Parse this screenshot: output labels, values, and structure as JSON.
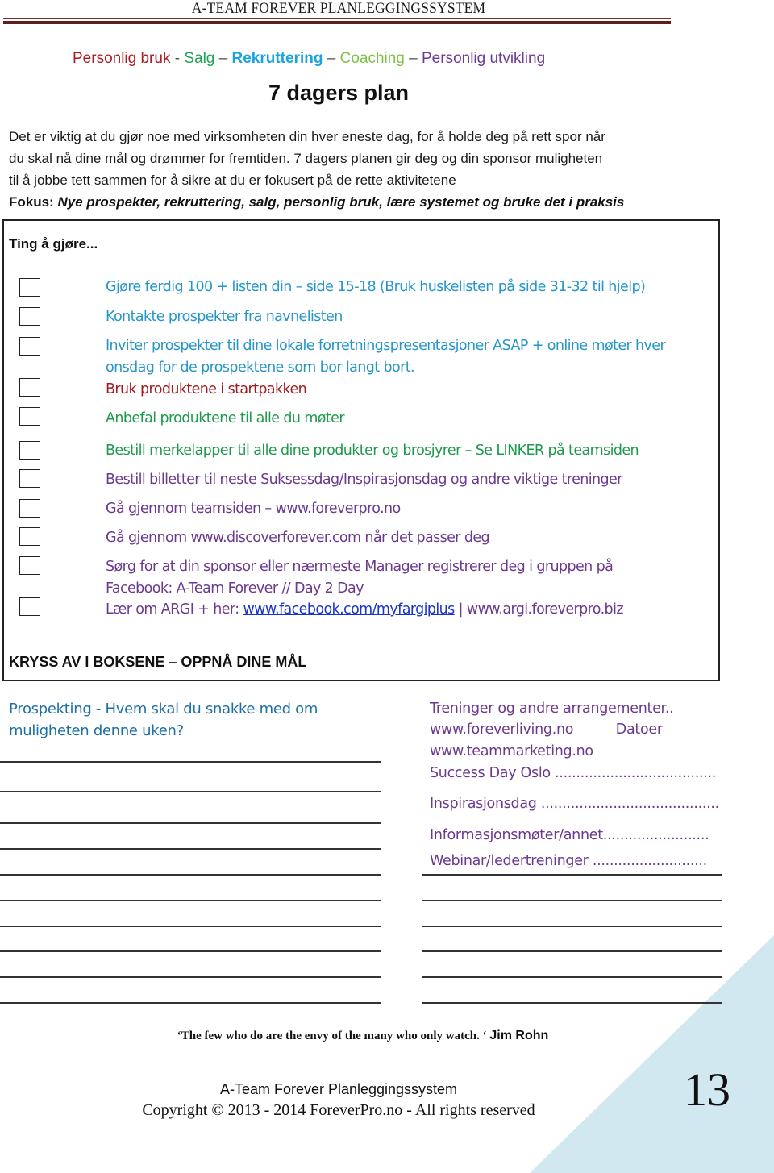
{
  "header": {
    "title": "A-TEAM FOREVER PLANLEGGINGSSYSTEM",
    "rule_color": "#5e1f1f"
  },
  "tagline": [
    {
      "text": "Personlig bruk",
      "color": "#ad1c24"
    },
    {
      "text": " - ",
      "color": "#555555"
    },
    {
      "text": "Salg",
      "color": "#1fa055"
    },
    {
      "text": " – ",
      "color": "#555555"
    },
    {
      "text": "Rekruttering",
      "color": "#1aa3de"
    },
    {
      "text": " – ",
      "color": "#555555"
    },
    {
      "text": "Coaching",
      "color": "#7dc243"
    },
    {
      "text": " – ",
      "color": "#555555"
    },
    {
      "text": "Personlig utvikling",
      "color": "#6f3a96"
    }
  ],
  "page_title": "7 dagers plan",
  "intro": {
    "lines": [
      "Det er viktig at du gjør noe med virksomheten din hver eneste dag, for å holde deg på rett spor når",
      "du skal nå dine mål og drømmer for fremtiden. 7 dagers planen gir deg og din sponsor muligheten",
      "til å jobbe tett sammen for å sikre at du er fokusert på de rette aktivitetene"
    ],
    "focus_label": "Fokus:",
    "focus_text": " Nye prospekter, rekruttering, salg, personlig bruk, lære systemet og bruke det i praksis"
  },
  "todo": {
    "heading": "Ting å gjøre...",
    "footer": "KRYSS AV I BOKSENE – OPPNÅ DINE MÅL",
    "items": [
      {
        "lines": [
          "Gjøre ferdig 100 + listen din – side 15-18 (Bruk huskelisten på side 31-32 til hjelp)"
        ],
        "color": "#2596c8",
        "checked": false
      },
      {
        "lines": [
          "Kontakte prospekter fra navnelisten"
        ],
        "color": "#2596c8",
        "checked": false
      },
      {
        "lines": [
          "Inviter prospekter til dine lokale forretningspresentasjoner ASAP + online møter hver",
          "onsdag for de prospektene som bor langt bort."
        ],
        "color": "#2596c8",
        "checked": false
      },
      {
        "lines": [
          "Bruk produktene i startpakken"
        ],
        "color": "#a01c20",
        "checked": false
      },
      {
        "lines": [
          "Anbefal produktene til alle du møter"
        ],
        "color": "#1e9a4c",
        "checked": false
      },
      {
        "lines": [
          "Bestill merkelapper til alle dine produkter og brosjyrer – Se LINKER på teamsiden"
        ],
        "color": "#1e9a4c",
        "checked": false
      },
      {
        "lines": [
          "Bestill billetter til neste Suksessdag/Inspirasjonsdag og andre viktige treninger"
        ],
        "color": "#6b3a8f",
        "checked": false
      },
      {
        "lines": [
          "Gå gjennom teamsiden – www.foreverpro.no"
        ],
        "color": "#6b3a8f",
        "checked": false
      },
      {
        "lines": [
          "Gå gjennom www.discoverforever.com når det passer deg"
        ],
        "color": "#6b3a8f",
        "checked": false
      },
      {
        "lines": [
          "Sørg for at din sponsor eller nærmeste Manager registrerer deg i gruppen på",
          "Facebook:  A-Team Forever // Day 2 Day"
        ],
        "color": "#6b3a8f",
        "checked": false
      },
      {
        "prefix": "Lær om ARGI + her: ",
        "link": "www.facebook.com/myfargiplus",
        "suffix": " | www.argi.foreverpro.biz",
        "color": "#6b3a8f",
        "link_color": "#1a33c8",
        "checked": false
      }
    ]
  },
  "prospecting": {
    "lines": [
      "Prospekting - Hvem skal du snakke med om",
      "muligheten denne uken?"
    ],
    "color": "#1d6fa8",
    "blank_lines": 10
  },
  "trainings": {
    "color": "#6b3a8f",
    "rows": [
      "Treninger og andre arrangementer..",
      "www.foreverliving.no          Datoer",
      "www.teammarketing.no",
      "Success Day Oslo ......................................",
      "Inspirasjonsdag ..........................................",
      "Informasjonsmøter/annet.........................",
      "Webinar/ledertreninger ..........................."
    ],
    "blank_lines": 6
  },
  "quote": {
    "text": "‘The few who do are the envy of the many who only watch. ‘ ",
    "author": "Jim Rohn"
  },
  "footer": {
    "line1": "A-Team Forever Planleggingssystem",
    "line2": "Copyright © 2013 - 2014 ForeverPro.no - All rights reserved",
    "page_number": "13",
    "accent_color": "#d2e8f1"
  }
}
